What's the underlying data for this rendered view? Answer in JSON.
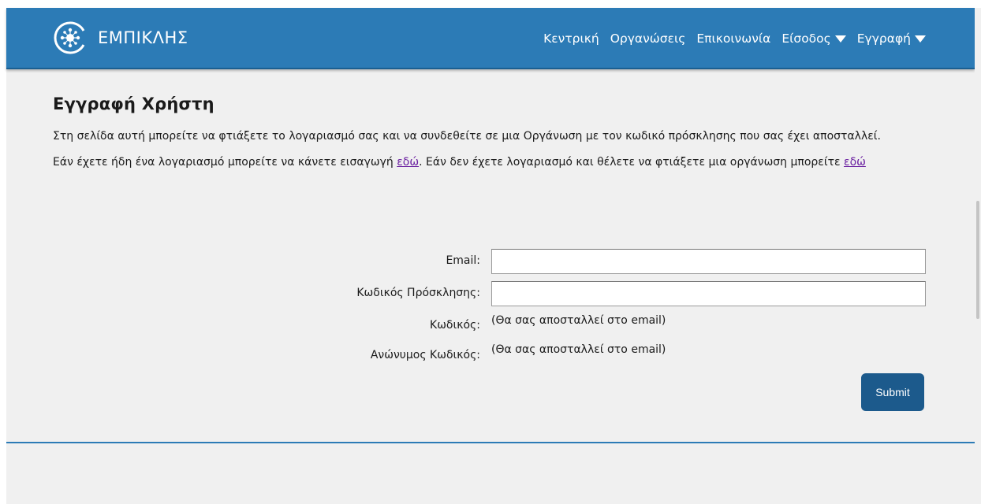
{
  "brand": {
    "name": "ΕΜΠΙΚΛΗΣ",
    "logo_icon": "network-circle-logo"
  },
  "nav": {
    "items": [
      {
        "label": "Κεντρική",
        "dropdown": false
      },
      {
        "label": "Οργανώσεις",
        "dropdown": false
      },
      {
        "label": "Επικοινωνία",
        "dropdown": false
      },
      {
        "label": "Είσοδος",
        "dropdown": true
      },
      {
        "label": "Εγγραφή",
        "dropdown": true
      }
    ]
  },
  "main": {
    "title": "Εγγραφή Χρήστη",
    "intro": "Στη σελίδα αυτή μπορείτε να φτιάξετε το λογαριασμό σας και να συνδεθείτε σε μια Οργάνωση με τον κωδικό πρόσκλησης που σας έχει αποσταλλεί.",
    "login_text_before": "Εάν έχετε ήδη ένα λογαριασμό μπορείτε να κάνετε εισαγωγή ",
    "login_link": "εδώ",
    "login_text_after": ". Εάν δεν έχετε λογαριασμό και θέλετε να φτιάξετε μια οργάνωση μπορείτε ",
    "create_org_link": "εδώ"
  },
  "form": {
    "email_label": "Email:",
    "email_value": "",
    "invite_code_label": "Κωδικός Πρόσκλησης:",
    "invite_code_value": "",
    "password_label": "Κωδικός:",
    "password_note": "(Θα σας αποσταλλεί στο email)",
    "anon_password_label": "Ανώνυμος Κωδικός:",
    "anon_password_note": "(Θα σας αποσταλλεί στο email)",
    "submit_label": "Submit"
  },
  "colors": {
    "navbar": "#2c7bb6",
    "button": "#1c5a8c",
    "link": "#6a1fa0",
    "background": "#f0f0f0"
  }
}
